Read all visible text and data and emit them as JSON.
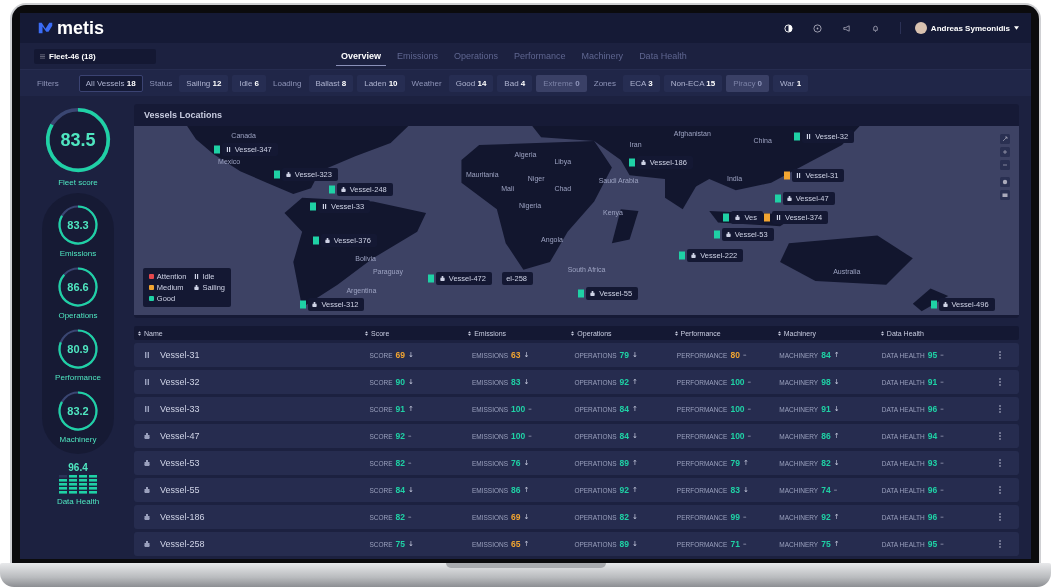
{
  "header": {
    "logo": "metis",
    "user": {
      "name": "Andreas Symeonidis"
    }
  },
  "fleet_selector": {
    "value": "Fleet-46 (18)"
  },
  "tabs": [
    {
      "label": "Overview",
      "selected": true
    },
    {
      "label": "Emissions",
      "selected": false
    },
    {
      "label": "Operations",
      "selected": false
    },
    {
      "label": "Performance",
      "selected": false
    },
    {
      "label": "Machinery",
      "selected": false
    },
    {
      "label": "Data Health",
      "selected": false
    }
  ],
  "filters": {
    "label": "Filters",
    "items": [
      {
        "kind": "chip",
        "label": "All Vessels",
        "count": "18",
        "selected": true,
        "disabled": false
      },
      {
        "kind": "group",
        "label": "Status"
      },
      {
        "kind": "chip",
        "label": "Sailing",
        "count": "12",
        "selected": false,
        "disabled": false
      },
      {
        "kind": "chip",
        "label": "Idle",
        "count": "6",
        "selected": false,
        "disabled": false
      },
      {
        "kind": "group",
        "label": "Loading"
      },
      {
        "kind": "chip",
        "label": "Ballast",
        "count": "8",
        "selected": false,
        "disabled": false
      },
      {
        "kind": "chip",
        "label": "Laden",
        "count": "10",
        "selected": false,
        "disabled": false
      },
      {
        "kind": "group",
        "label": "Weather"
      },
      {
        "kind": "chip",
        "label": "Good",
        "count": "14",
        "selected": false,
        "disabled": false
      },
      {
        "kind": "chip",
        "label": "Bad",
        "count": "4",
        "selected": false,
        "disabled": false
      },
      {
        "kind": "chip",
        "label": "Extreme",
        "count": "0",
        "selected": false,
        "disabled": true
      },
      {
        "kind": "group",
        "label": "Zones"
      },
      {
        "kind": "chip",
        "label": "ECA",
        "count": "3",
        "selected": false,
        "disabled": false
      },
      {
        "kind": "chip",
        "label": "Non-ECA",
        "count": "15",
        "selected": false,
        "disabled": false
      },
      {
        "kind": "chip",
        "label": "Piracy",
        "count": "0",
        "selected": false,
        "disabled": true
      },
      {
        "kind": "chip",
        "label": "War",
        "count": "1",
        "selected": false,
        "disabled": false
      }
    ]
  },
  "scores": {
    "fleet": {
      "value": "83.5",
      "label": "Fleet score",
      "level": 0.835
    },
    "categories": [
      {
        "value": "83.3",
        "label": "Emissions",
        "level": 0.833
      },
      {
        "value": "86.6",
        "label": "Operations",
        "level": 0.866
      },
      {
        "value": "80.9",
        "label": "Performance",
        "level": 0.809
      },
      {
        "value": "83.2",
        "label": "Machinery",
        "level": 0.832
      }
    ],
    "data_health": {
      "value": "96.4",
      "label": "Data Health",
      "level": 0.964
    }
  },
  "map": {
    "title": "Vessels Locations",
    "country_labels": [
      "Canada",
      "Mexico",
      "Bolivia",
      "Paraguay",
      "Argentina",
      "Mauritania",
      "Mali",
      "Niger",
      "Chad",
      "Algeria",
      "Libya",
      "Nigeria",
      "Angola",
      "South Africa",
      "Saudi Arabia",
      "Kenya",
      "Iran",
      "Afghanistan",
      "India",
      "China",
      "Australia"
    ],
    "markers": [
      {
        "label": "Vessel-347",
        "kind": "idle",
        "color": "#1fd1a5"
      },
      {
        "label": "Vessel-323",
        "kind": "sailing",
        "color": "#1fd1a5"
      },
      {
        "label": "Vessel-248",
        "kind": "sailing",
        "color": "#1fd1a5"
      },
      {
        "label": "Vessel-33",
        "kind": "idle",
        "color": "#1fd1a5"
      },
      {
        "label": "Vessel-376",
        "kind": "sailing",
        "color": "#1fd1a5"
      },
      {
        "label": "el-258",
        "kind": "text"
      },
      {
        "label": "Vessel-472",
        "kind": "sailing",
        "color": "#1fd1a5"
      },
      {
        "label": "Vessel-312",
        "kind": "sailing",
        "color": "#1fd1a5"
      },
      {
        "label": "Vessel-55",
        "kind": "sailing",
        "color": "#1fd1a5"
      },
      {
        "label": "Vessel-186",
        "kind": "sailing",
        "color": "#1fd1a5"
      },
      {
        "label": "Vessel-32",
        "kind": "idle",
        "color": "#1fd1a5"
      },
      {
        "label": "Vessel-31",
        "kind": "idle",
        "color": "#f2a531"
      },
      {
        "label": "Vessel-47",
        "kind": "sailing",
        "color": "#1fd1a5"
      },
      {
        "label": "Ves",
        "kind": "sailing",
        "color": "#1fd1a5"
      },
      {
        "label": "Vessel-374",
        "kind": "idle",
        "color": "#f2a531"
      },
      {
        "label": "Vessel-53",
        "kind": "sailing",
        "color": "#1fd1a5"
      },
      {
        "label": "Vessel-222",
        "kind": "sailing",
        "color": "#1fd1a5"
      },
      {
        "label": "Vessel-496",
        "kind": "sailing",
        "color": "#1fd1a5"
      }
    ],
    "legend": [
      {
        "label": "Attention",
        "kind": "dot",
        "color": "#e5484d"
      },
      {
        "label": "Idle",
        "kind": "idle"
      },
      {
        "label": "Medium",
        "kind": "dot",
        "color": "#f2a531"
      },
      {
        "label": "Sailing",
        "kind": "sailing"
      },
      {
        "label": "Good",
        "kind": "dot",
        "color": "#1fd1a5"
      }
    ]
  },
  "table": {
    "columns": [
      "Name",
      "Score",
      "Emissions",
      "Operations",
      "Performance",
      "Machinery",
      "Data Health"
    ],
    "rows": [
      {
        "cells": [
          {
            "kind": "idle",
            "text": "Vessel-31"
          },
          {
            "kind": "metric",
            "label": "SCORE",
            "value": "69",
            "color": "#f2a531",
            "trend": "↓"
          },
          {
            "kind": "metric",
            "label": "EMISSIONS",
            "value": "63",
            "color": "#f2a531",
            "trend": "↓"
          },
          {
            "kind": "metric",
            "label": "OPERATIONS",
            "value": "79",
            "color": "#1fd1a5",
            "trend": "↓"
          },
          {
            "kind": "metric",
            "label": "PERFORMANCE",
            "value": "80",
            "color": "#f2a531",
            "trend": "–"
          },
          {
            "kind": "metric",
            "label": "MACHINERY",
            "value": "84",
            "color": "#1fd1a5",
            "trend": "↑"
          },
          {
            "kind": "metric",
            "label": "DATA HEALTH",
            "value": "95",
            "color": "#1fd1a5",
            "trend": "–"
          }
        ]
      },
      {
        "cells": [
          {
            "kind": "idle",
            "text": "Vessel-32"
          },
          {
            "kind": "metric",
            "label": "SCORE",
            "value": "90",
            "color": "#1fd1a5",
            "trend": "↓"
          },
          {
            "kind": "metric",
            "label": "EMISSIONS",
            "value": "83",
            "color": "#1fd1a5",
            "trend": "↓"
          },
          {
            "kind": "metric",
            "label": "OPERATIONS",
            "value": "92",
            "color": "#1fd1a5",
            "trend": "↑"
          },
          {
            "kind": "metric",
            "label": "PERFORMANCE",
            "value": "100",
            "color": "#1fd1a5",
            "trend": "–"
          },
          {
            "kind": "metric",
            "label": "MACHINERY",
            "value": "98",
            "color": "#1fd1a5",
            "trend": "↓"
          },
          {
            "kind": "metric",
            "label": "DATA HEALTH",
            "value": "91",
            "color": "#1fd1a5",
            "trend": "–"
          }
        ]
      },
      {
        "cells": [
          {
            "kind": "idle",
            "text": "Vessel-33"
          },
          {
            "kind": "metric",
            "label": "SCORE",
            "value": "91",
            "color": "#1fd1a5",
            "trend": "↑"
          },
          {
            "kind": "metric",
            "label": "EMISSIONS",
            "value": "100",
            "color": "#1fd1a5",
            "trend": "–"
          },
          {
            "kind": "metric",
            "label": "OPERATIONS",
            "value": "84",
            "color": "#1fd1a5",
            "trend": "↑"
          },
          {
            "kind": "metric",
            "label": "PERFORMANCE",
            "value": "100",
            "color": "#1fd1a5",
            "trend": "–"
          },
          {
            "kind": "metric",
            "label": "MACHINERY",
            "value": "91",
            "color": "#1fd1a5",
            "trend": "↓"
          },
          {
            "kind": "metric",
            "label": "DATA HEALTH",
            "value": "96",
            "color": "#1fd1a5",
            "trend": "–"
          }
        ]
      },
      {
        "cells": [
          {
            "kind": "sailing",
            "text": "Vessel-47"
          },
          {
            "kind": "metric",
            "label": "SCORE",
            "value": "92",
            "color": "#1fd1a5",
            "trend": "–"
          },
          {
            "kind": "metric",
            "label": "EMISSIONS",
            "value": "100",
            "color": "#1fd1a5",
            "trend": "–"
          },
          {
            "kind": "metric",
            "label": "OPERATIONS",
            "value": "84",
            "color": "#1fd1a5",
            "trend": "↓"
          },
          {
            "kind": "metric",
            "label": "PERFORMANCE",
            "value": "100",
            "color": "#1fd1a5",
            "trend": "–"
          },
          {
            "kind": "metric",
            "label": "MACHINERY",
            "value": "86",
            "color": "#1fd1a5",
            "trend": "↑"
          },
          {
            "kind": "metric",
            "label": "DATA HEALTH",
            "value": "94",
            "color": "#1fd1a5",
            "trend": "–"
          }
        ]
      },
      {
        "cells": [
          {
            "kind": "sailing",
            "text": "Vessel-53"
          },
          {
            "kind": "metric",
            "label": "SCORE",
            "value": "82",
            "color": "#1fd1a5",
            "trend": "–"
          },
          {
            "kind": "metric",
            "label": "EMISSIONS",
            "value": "76",
            "color": "#1fd1a5",
            "trend": "↓"
          },
          {
            "kind": "metric",
            "label": "OPERATIONS",
            "value": "89",
            "color": "#1fd1a5",
            "trend": "↑"
          },
          {
            "kind": "metric",
            "label": "PERFORMANCE",
            "value": "79",
            "color": "#1fd1a5",
            "trend": "↑"
          },
          {
            "kind": "metric",
            "label": "MACHINERY",
            "value": "82",
            "color": "#1fd1a5",
            "trend": "↓"
          },
          {
            "kind": "metric",
            "label": "DATA HEALTH",
            "value": "93",
            "color": "#1fd1a5",
            "trend": "–"
          }
        ]
      },
      {
        "cells": [
          {
            "kind": "sailing",
            "text": "Vessel-55"
          },
          {
            "kind": "metric",
            "label": "SCORE",
            "value": "84",
            "color": "#1fd1a5",
            "trend": "↓"
          },
          {
            "kind": "metric",
            "label": "EMISSIONS",
            "value": "86",
            "color": "#1fd1a5",
            "trend": "↑"
          },
          {
            "kind": "metric",
            "label": "OPERATIONS",
            "value": "92",
            "color": "#1fd1a5",
            "trend": "↑"
          },
          {
            "kind": "metric",
            "label": "PERFORMANCE",
            "value": "83",
            "color": "#1fd1a5",
            "trend": "↓"
          },
          {
            "kind": "metric",
            "label": "MACHINERY",
            "value": "74",
            "color": "#1fd1a5",
            "trend": "–"
          },
          {
            "kind": "metric",
            "label": "DATA HEALTH",
            "value": "96",
            "color": "#1fd1a5",
            "trend": "–"
          }
        ]
      },
      {
        "cells": [
          {
            "kind": "sailing",
            "text": "Vessel-186"
          },
          {
            "kind": "metric",
            "label": "SCORE",
            "value": "82",
            "color": "#1fd1a5",
            "trend": "–"
          },
          {
            "kind": "metric",
            "label": "EMISSIONS",
            "value": "69",
            "color": "#f2a531",
            "trend": "↓"
          },
          {
            "kind": "metric",
            "label": "OPERATIONS",
            "value": "82",
            "color": "#1fd1a5",
            "trend": "↓"
          },
          {
            "kind": "metric",
            "label": "PERFORMANCE",
            "value": "99",
            "color": "#1fd1a5",
            "trend": "–"
          },
          {
            "kind": "metric",
            "label": "MACHINERY",
            "value": "92",
            "color": "#1fd1a5",
            "trend": "↑"
          },
          {
            "kind": "metric",
            "label": "DATA HEALTH",
            "value": "96",
            "color": "#1fd1a5",
            "trend": "–"
          }
        ]
      },
      {
        "cells": [
          {
            "kind": "sailing",
            "text": "Vessel-258"
          },
          {
            "kind": "metric",
            "label": "SCORE",
            "value": "75",
            "color": "#1fd1a5",
            "trend": "↓"
          },
          {
            "kind": "metric",
            "label": "EMISSIONS",
            "value": "65",
            "color": "#f2a531",
            "trend": "↑"
          },
          {
            "kind": "metric",
            "label": "OPERATIONS",
            "value": "89",
            "color": "#1fd1a5",
            "trend": "↓"
          },
          {
            "kind": "metric",
            "label": "PERFORMANCE",
            "value": "71",
            "color": "#1fd1a5",
            "trend": "–"
          },
          {
            "kind": "metric",
            "label": "MACHINERY",
            "value": "75",
            "color": "#1fd1a5",
            "trend": "↑"
          },
          {
            "kind": "metric",
            "label": "DATA HEALTH",
            "value": "95",
            "color": "#1fd1a5",
            "trend": "–"
          }
        ]
      }
    ]
  }
}
